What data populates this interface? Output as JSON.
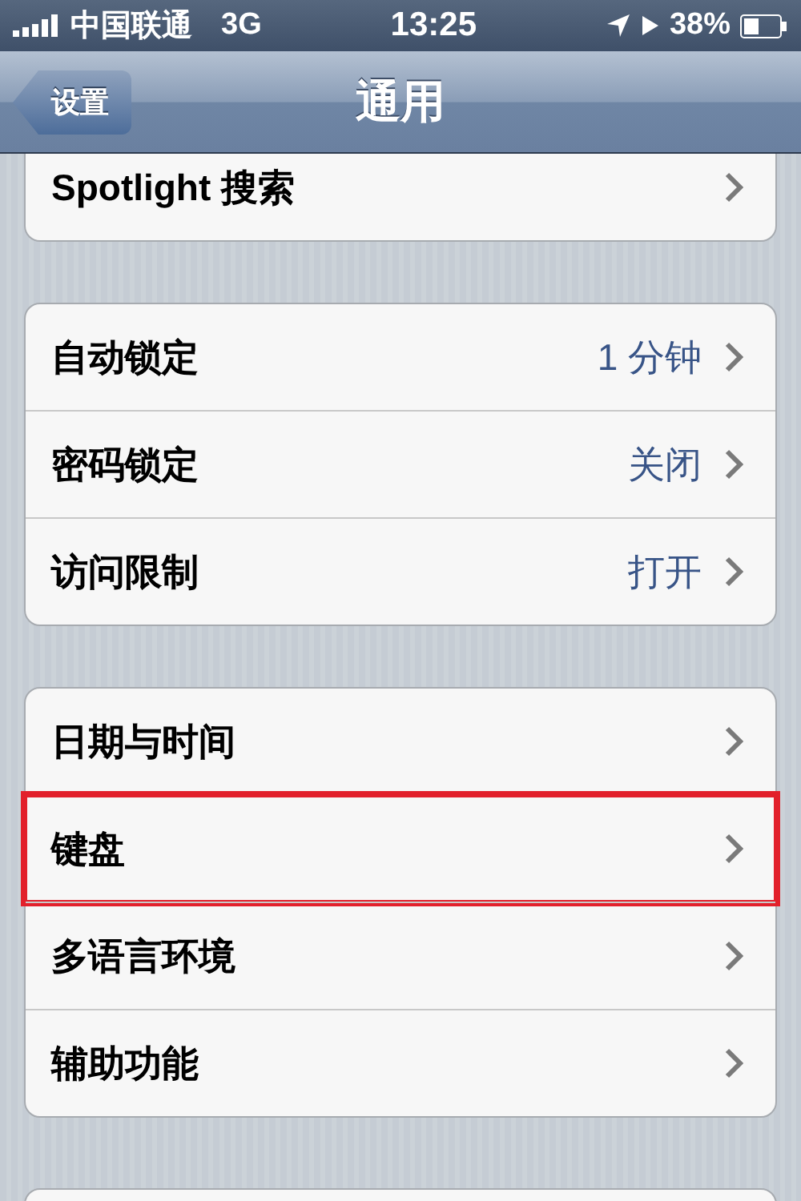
{
  "status_bar": {
    "carrier": "中国联通",
    "network": "3G",
    "time": "13:25",
    "battery": "38%"
  },
  "nav_bar": {
    "back": "设置",
    "title": "通用"
  },
  "groups": [
    {
      "rows": [
        {
          "label": "Spotlight 搜索",
          "highlighted": false
        }
      ]
    },
    {
      "rows": [
        {
          "label": "自动锁定",
          "value": "1 分钟",
          "highlighted": false
        },
        {
          "label": "密码锁定",
          "value": "关闭",
          "highlighted": false
        },
        {
          "label": "访问限制",
          "value": "打开",
          "highlighted": false
        }
      ]
    },
    {
      "rows": [
        {
          "label": "日期与时间",
          "highlighted": false
        },
        {
          "label": "键盘",
          "highlighted": true
        },
        {
          "label": "多语言环境",
          "highlighted": false
        },
        {
          "label": "辅助功能",
          "highlighted": false
        }
      ]
    }
  ],
  "more_below": true
}
